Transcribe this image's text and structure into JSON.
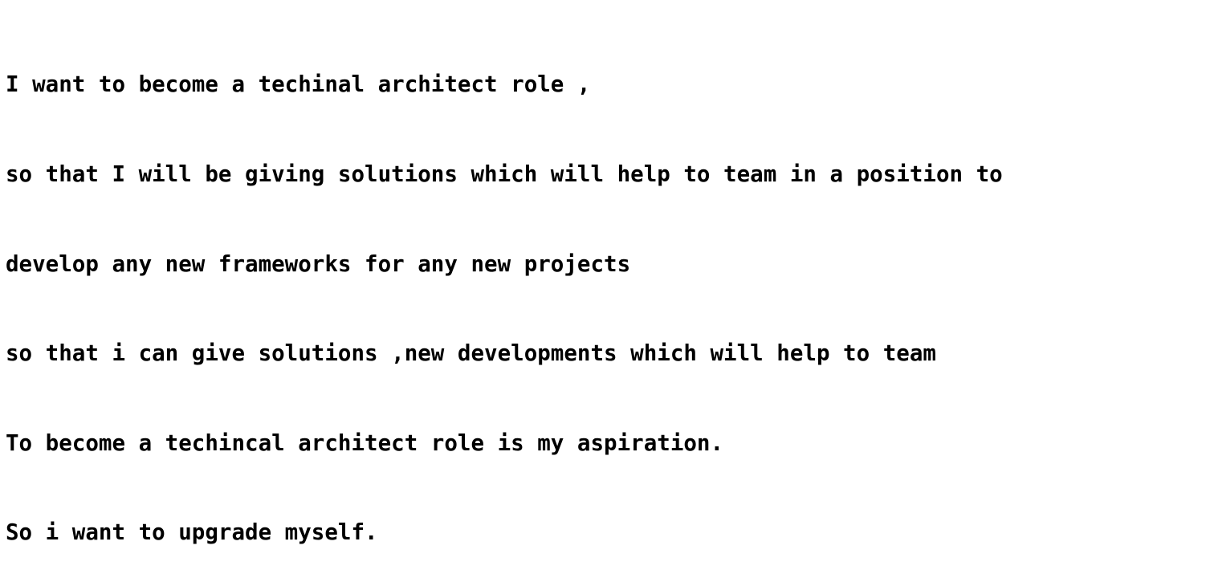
{
  "document": {
    "lines": [
      "I want to become a techinal architect role ,",
      "so that I will be giving solutions which will help to team in a position to",
      "develop any new frameworks for any new projects",
      "so that i can give solutions ,new developments which will help to team",
      "To become a techincal architect role is my aspiration.",
      "So i want to upgrade myself."
    ]
  }
}
